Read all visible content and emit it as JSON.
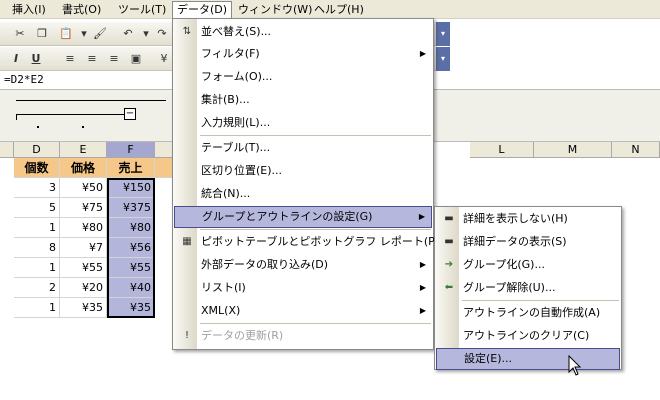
{
  "menubar": {
    "items": [
      "挿入(I)",
      "書式(O)",
      "ツール(T)",
      "データ(D)",
      "ウィンドウ(W)",
      "ヘルプ(H)"
    ]
  },
  "formula_bar": {
    "formula": "=D2*E2"
  },
  "columns": {
    "left": [
      "D",
      "E",
      "F"
    ],
    "right": [
      "L",
      "M",
      "N"
    ]
  },
  "table": {
    "headers": [
      "個数",
      "価格",
      "売上"
    ],
    "rows": [
      [
        "3",
        "¥50",
        "¥150"
      ],
      [
        "5",
        "¥75",
        "¥375"
      ],
      [
        "1",
        "¥80",
        "¥80"
      ],
      [
        "8",
        "¥7",
        "¥56"
      ],
      [
        "1",
        "¥55",
        "¥55"
      ],
      [
        "2",
        "¥20",
        "¥40"
      ],
      [
        "1",
        "¥35",
        "¥35"
      ]
    ]
  },
  "data_menu": {
    "items": [
      "並べ替え(S)...",
      "フィルタ(F)",
      "フォーム(O)...",
      "集計(B)...",
      "入力規則(L)...",
      "テーブル(T)...",
      "区切り位置(E)...",
      "統合(N)...",
      "グループとアウトラインの設定(G)",
      "ピボットテーブルとピボットグラフ レポート(P)...",
      "外部データの取り込み(D)",
      "リスト(I)",
      "XML(X)",
      "データの更新(R)"
    ]
  },
  "outline_submenu": {
    "items": [
      "詳細を表示しない(H)",
      "詳細データの表示(S)",
      "グループ化(G)...",
      "グループ解除(U)...",
      "アウトラインの自動作成(A)",
      "アウトラインのクリア(C)",
      "設定(E)..."
    ]
  },
  "colors": {
    "highlight": "#b6b7dd",
    "header_fill": "#f5c88a",
    "selected_col": "#a6a7d0"
  }
}
